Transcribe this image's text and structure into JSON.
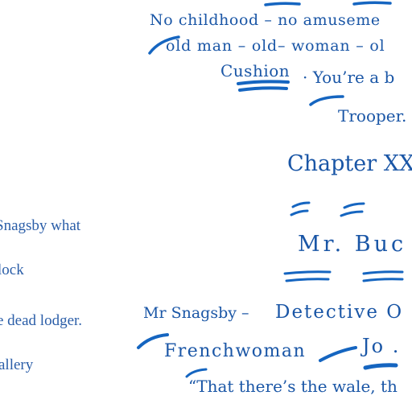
{
  "left_notes": [
    "Snagsby what",
    "lock",
    "e dead lodger.",
    "allery"
  ],
  "right_notes": {
    "line1": "No childhood – no amuseme",
    "line2": "old man – old– woman – ol",
    "line3_a": "Cushion",
    "line3_b": "· You’re a b",
    "line4": "Trooper.",
    "chapter": "Chapter XX",
    "heading": "Mr. Buc",
    "detective_a": "Mr Snagsby –",
    "detective_b": "Detective O",
    "frenchwoman": "Frenchwoman",
    "jo": "Jo .",
    "quote": "“That there’s the wale, th"
  },
  "colors": {
    "ink": "#1a56a6",
    "mark": "#1565c0"
  }
}
